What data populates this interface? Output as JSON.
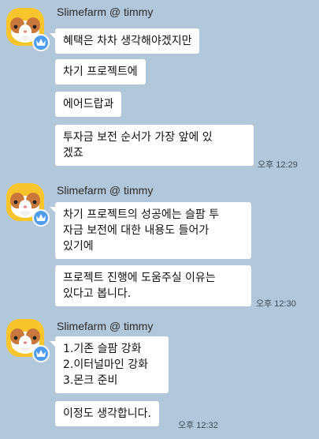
{
  "groups": [
    {
      "sender": "Slimefarm @ timmy",
      "messages": [
        "혜택은 차차 생각해야겠지만",
        "차기 프로젝트에",
        "에어드랍과",
        "투자금 보전 순서가 가장 앞에 있\n겠죠"
      ],
      "time": "오후 12:29"
    },
    {
      "sender": "Slimefarm @ timmy",
      "messages": [
        "차기 프로젝트의 성공에는 슬팜 투\n자금 보전에 대한 내용도 들어가\n있기에",
        "프로젝트 진행에 도움주실 이유는\n있다고 봅니다."
      ],
      "time": "오후 12:30"
    },
    {
      "sender": "Slimefarm @ timmy",
      "messages": [
        "1.기존 슬팜 강화\n2.이터널마인 강화\n3.몬크 준비",
        "이정도 생각합니다."
      ],
      "time": "오후 12:32"
    }
  ],
  "icons": {
    "avatar": "hamster-avatar-icon",
    "badge": "crown-badge-icon"
  },
  "colors": {
    "background": "#b2c7d9",
    "bubble": "#ffffff",
    "avatar_bg": "#f7c52b",
    "badge": "#4e9cf0"
  }
}
